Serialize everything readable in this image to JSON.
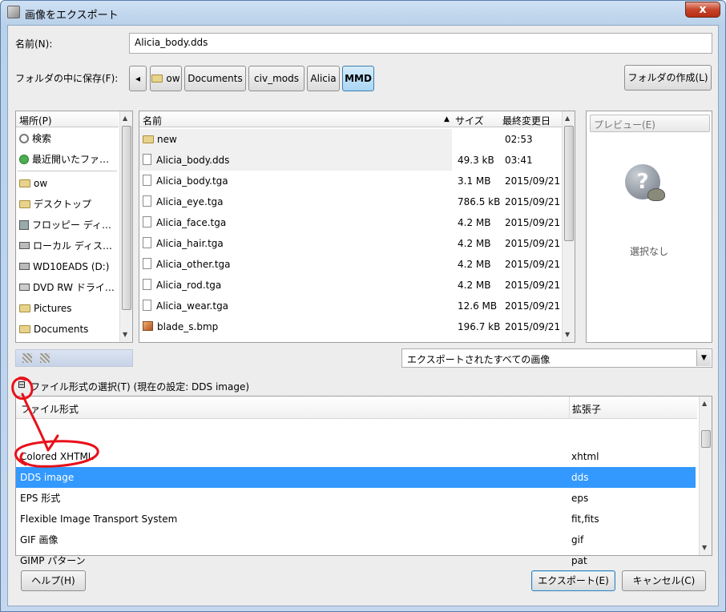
{
  "window": {
    "title": "画像をエクスポート",
    "close_glyph": "x"
  },
  "name_field": {
    "label": "名前(N):",
    "value": "Alicia_body.dds"
  },
  "save_in": {
    "label": "フォルダの中に保存(F):",
    "back_glyph": "◂",
    "crumbs": [
      "ow",
      "Documents",
      "civ_mods",
      "Alicia",
      "MMD"
    ],
    "create_folder_label": "フォルダの作成(L)"
  },
  "places": {
    "header": "場所(P)",
    "items": [
      {
        "label": "検索",
        "icon": "search-icon"
      },
      {
        "label": "最近開いたファ…",
        "icon": "recent-icon"
      },
      {
        "label": "ow",
        "icon": "folder-icon"
      },
      {
        "label": "デスクトップ",
        "icon": "folder-icon"
      },
      {
        "label": "フロッピー ディ…",
        "icon": "floppy-icon"
      },
      {
        "label": "ローカル ディス…",
        "icon": "drive-icon"
      },
      {
        "label": "WD10EADS (D:)",
        "icon": "drive-icon"
      },
      {
        "label": "DVD RW ドライ…",
        "icon": "dvd-icon"
      },
      {
        "label": "Pictures",
        "icon": "folder-icon"
      },
      {
        "label": "Documents",
        "icon": "folder-icon"
      }
    ],
    "up_glyph": "▲",
    "down_glyph": "▼"
  },
  "files": {
    "headers": {
      "name": "名前",
      "size": "サイズ",
      "modified": "最終変更日",
      "sort_glyph": "▲"
    },
    "rows": [
      {
        "name": "new",
        "size": "",
        "modified": "02:53",
        "kind": "folder"
      },
      {
        "name": "Alicia_body.dds",
        "size": "49.3 kB",
        "modified": "03:41",
        "kind": "file"
      },
      {
        "name": "Alicia_body.tga",
        "size": "3.1 MB",
        "modified": "2015/09/21",
        "kind": "file"
      },
      {
        "name": "Alicia_eye.tga",
        "size": "786.5 kB",
        "modified": "2015/09/21",
        "kind": "file"
      },
      {
        "name": "Alicia_face.tga",
        "size": "4.2 MB",
        "modified": "2015/09/21",
        "kind": "file"
      },
      {
        "name": "Alicia_hair.tga",
        "size": "4.2 MB",
        "modified": "2015/09/21",
        "kind": "file"
      },
      {
        "name": "Alicia_other.tga",
        "size": "4.2 MB",
        "modified": "2015/09/21",
        "kind": "file"
      },
      {
        "name": "Alicia_rod.tga",
        "size": "4.2 MB",
        "modified": "2015/09/21",
        "kind": "file"
      },
      {
        "name": "Alicia_wear.tga",
        "size": "12.6 MB",
        "modified": "2015/09/21",
        "kind": "file"
      },
      {
        "name": "blade_s.bmp",
        "size": "196.7 kB",
        "modified": "2015/09/21",
        "kind": "image"
      }
    ]
  },
  "preview": {
    "header": "プレビュー(E)",
    "empty_text": "選択なし",
    "question_glyph": "?"
  },
  "filter": {
    "value": "エクスポートされたすべての画像",
    "arrow_glyph": "▼"
  },
  "filetype": {
    "toggle_glyph": "⊟",
    "label": "ファイル形式の選択(T) (現在の設定: DDS image)",
    "headers": {
      "format": "ファイル形式",
      "ext": "拡張子"
    },
    "rows": [
      {
        "format": "Colored XHTML",
        "ext": "xhtml",
        "selected": false
      },
      {
        "format": "DDS image",
        "ext": "dds",
        "selected": true
      },
      {
        "format": "EPS 形式",
        "ext": "eps",
        "selected": false
      },
      {
        "format": "Flexible Image Transport System",
        "ext": "fit,fits",
        "selected": false
      },
      {
        "format": "GIF 画像",
        "ext": "gif",
        "selected": false
      },
      {
        "format": "GIMP パターン",
        "ext": "pat",
        "selected": false
      }
    ]
  },
  "buttons": {
    "help": "ヘルプ(H)",
    "export": "エクスポート(E)",
    "cancel": "キャンセル(C)"
  },
  "colors": {
    "selection": "#3399ff",
    "annotation": "#e8101a"
  }
}
